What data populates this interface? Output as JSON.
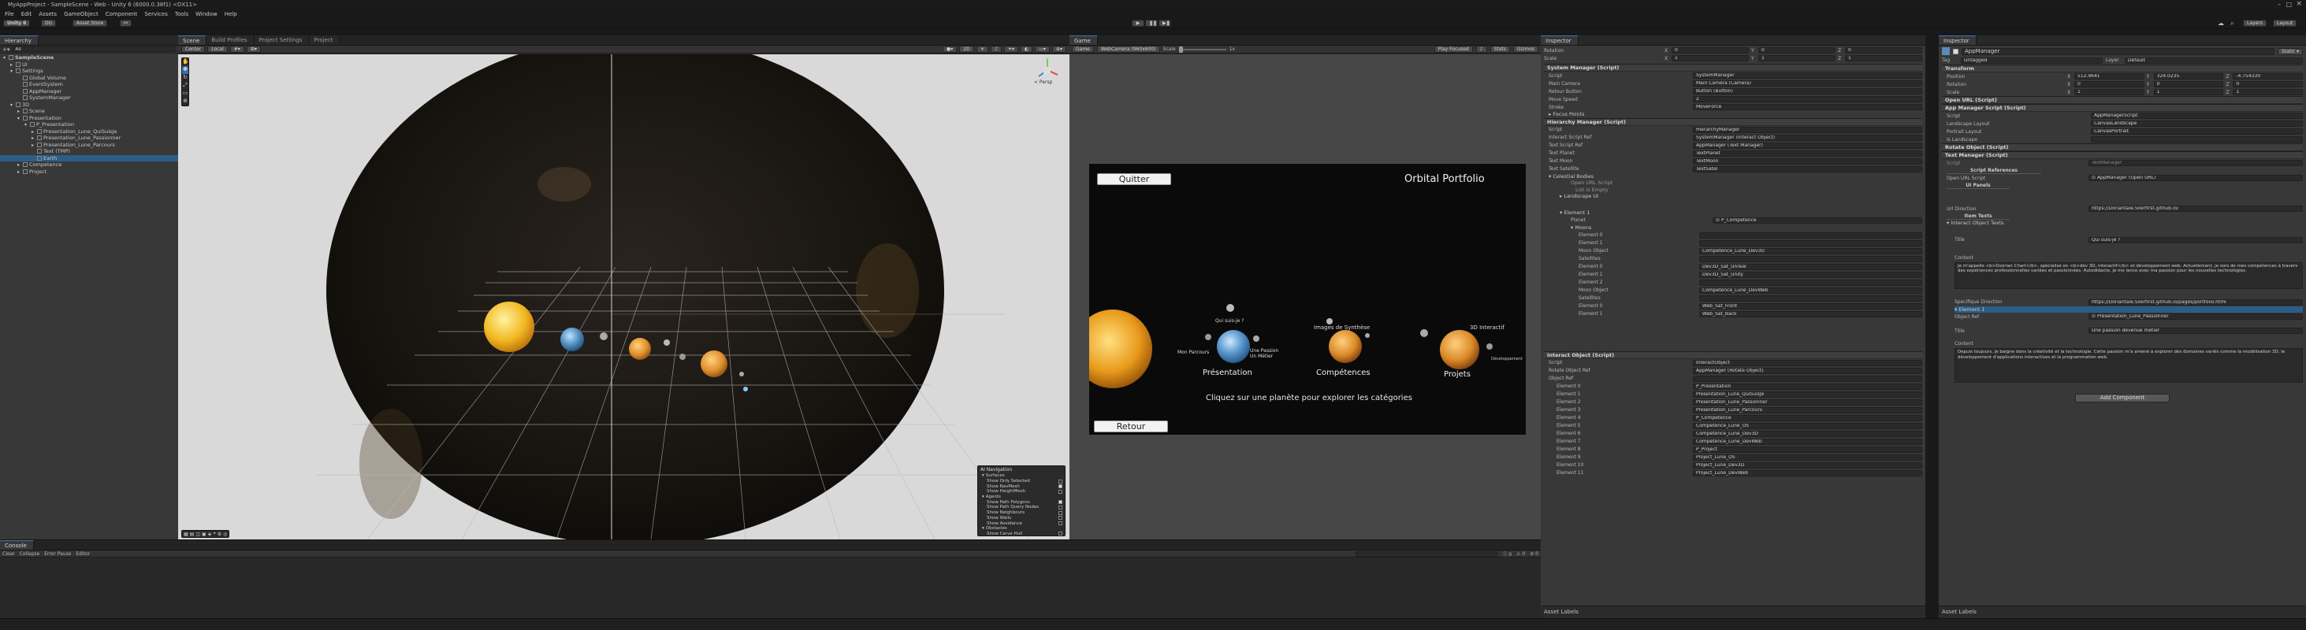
{
  "title_bar": {
    "text": "MyAppProject - SampleScene - Web - Unity 6 (6000.0.38f1) <DX11>"
  },
  "menu_items": [
    "File",
    "Edit",
    "Assets",
    "GameObject",
    "Component",
    "Services",
    "Tools",
    "Window",
    "Help"
  ],
  "toolbar": {
    "unity_label": "Unity 6",
    "account_label": "DG",
    "asset_store_label": "Asset Store",
    "layers_label": "Layers",
    "layout_label": "Layout"
  },
  "hierarchy": {
    "tab_label": "Hierarchy",
    "search_label": "All",
    "items": [
      {
        "label": "SampleScene",
        "depth": 0,
        "bold": true,
        "arrow": "▾"
      },
      {
        "label": "UI",
        "depth": 1,
        "arrow": "▸"
      },
      {
        "label": "Settings",
        "depth": 1,
        "arrow": "▾"
      },
      {
        "label": "Global Volume",
        "depth": 2,
        "arrow": ""
      },
      {
        "label": "EventSystem",
        "depth": 2,
        "arrow": ""
      },
      {
        "label": "AppManager",
        "depth": 2,
        "arrow": ""
      },
      {
        "label": "SystemManager",
        "depth": 2,
        "arrow": ""
      },
      {
        "label": "3D",
        "depth": 1,
        "arrow": "▾"
      },
      {
        "label": "Scene",
        "depth": 2,
        "arrow": "▸"
      },
      {
        "label": "Presentation",
        "depth": 2,
        "arrow": "▾"
      },
      {
        "label": "P_Presentation",
        "depth": 3,
        "arrow": "▾"
      },
      {
        "label": "Presentation_Lune_QuiSuisJe",
        "depth": 4,
        "arrow": "▸"
      },
      {
        "label": "Presentation_Lune_Passionner",
        "depth": 4,
        "arrow": "▸"
      },
      {
        "label": "Presentation_Lune_Parcours",
        "depth": 4,
        "arrow": "▸"
      },
      {
        "label": "Text (TMP)",
        "depth": 4,
        "arrow": ""
      },
      {
        "label": "Earth",
        "depth": 4,
        "arrow": "",
        "selected": true
      },
      {
        "label": "Competence",
        "depth": 2,
        "arrow": "▸"
      },
      {
        "label": "Project",
        "depth": 2,
        "arrow": "▸"
      }
    ]
  },
  "scene_tabs": [
    "Scene",
    "Build Profiles",
    "Project Settings",
    "Project"
  ],
  "scene_toolbar": {
    "center_label": "Center",
    "local_label": "Local",
    "persp_label": "< Persp"
  },
  "ai_nav": {
    "title": "AI Navigation",
    "items": [
      {
        "label": "Surfaces",
        "header": true
      },
      {
        "label": "Show Only Selected",
        "check": false
      },
      {
        "label": "Show NavMesh",
        "check": true
      },
      {
        "label": "Show HeightMesh",
        "check": false
      },
      {
        "label": "Agents",
        "header": true
      },
      {
        "label": "Show Path Polygons",
        "check": true
      },
      {
        "label": "Show Path Query Nodes",
        "check": false
      },
      {
        "label": "Show Neighbours",
        "check": false
      },
      {
        "label": "Show Walls",
        "check": false
      },
      {
        "label": "Show Avoidance",
        "check": false
      },
      {
        "label": "Obstacles",
        "header": true
      },
      {
        "label": "Show Carve Hull",
        "check": false
      }
    ]
  },
  "game_view": {
    "tab_label": "Game",
    "display_label": "Game",
    "resolution_label": "WebCamera (960x600)",
    "scale_label": "Scale",
    "scale_value": "1x",
    "play_focused_label": "Play Focused",
    "stats_label": "Stats",
    "gizmos_label": "Gizmos",
    "quit_button": "Quitter",
    "title": "Orbital Portfolio",
    "back_button": "Retour",
    "hint_text": "Cliquez sur une planète pour explorer les catégories",
    "labels": [
      {
        "text": "Qui suis-je ?"
      },
      {
        "text": "Mon Parcours"
      },
      {
        "text": "Une Passion Un Métier"
      },
      {
        "text": "Présentation"
      },
      {
        "text": "Images de Synthèse"
      },
      {
        "text": "3D Interactif"
      },
      {
        "text": "Compétences"
      },
      {
        "text": "Projets"
      },
      {
        "text": "Développement"
      }
    ]
  },
  "inspector1": {
    "tab_label": "Inspector",
    "top_rows": [
      {
        "label": "Rotation",
        "x": "0",
        "y": "0",
        "z": "0"
      },
      {
        "label": "Scale",
        "x": "1",
        "y": "1",
        "z": "1"
      }
    ],
    "system_manager": {
      "title": "System Manager (Script)",
      "fields": [
        {
          "label": "Script",
          "value": "SystemManager"
        },
        {
          "label": "Main Camera",
          "value": "Main Camera (Camera)"
        },
        {
          "label": "Retour Button",
          "value": "Button (Button)"
        },
        {
          "label": "Move Speed",
          "value": "2"
        },
        {
          "label": "Stroke",
          "value": "MoveForce"
        }
      ],
      "focus_points": "Focus Points"
    },
    "hierarchy_manager": {
      "title": "Hierarchy Manager (Script)",
      "fields": [
        {
          "label": "Script",
          "value": "HierarchyManager"
        },
        {
          "label": "Interact Script Ref",
          "value": "SystemManager (Interact Object)"
        },
        {
          "label": "Text Script Ref",
          "value": "AppManager (Text Manager)"
        },
        {
          "label": "Text Planet",
          "value": "TextPlanet"
        },
        {
          "label": "Text Moon",
          "value": "TextMoon"
        },
        {
          "label": "Text Satellite",
          "value": "TextSatel"
        }
      ],
      "celestial_bodies": "Celestial Bodies",
      "open_url_script": "Open URL Script",
      "list_empty": "List is Empty",
      "landscape_ui": "Landscape UI",
      "element1": "Element 1",
      "planet_value": "P_Competence",
      "moons_label": "Moons",
      "moon_elements": [
        {
          "label": "Element 0",
          "value": ""
        },
        {
          "label": "Element 1",
          "value": ""
        },
        {
          "label": "Moon Object",
          "value": "Competence_Lune_Dev3D"
        },
        {
          "label": "Satellites",
          "value": ""
        },
        {
          "label": "Element 0",
          "value": "Dev3D_Sat_Unreal"
        },
        {
          "label": "Element 1",
          "value": "Dev3D_Sat_Unity"
        },
        {
          "label": "Element 2",
          "value": ""
        },
        {
          "label": "Moon Object",
          "value": "Competence_Lune_DevWeb"
        },
        {
          "label": "Satellites",
          "value": ""
        },
        {
          "label": "Element 0",
          "value": "Web_Sat_Front"
        },
        {
          "label": "Element 1",
          "value": "Web_Sat_Back"
        }
      ]
    },
    "interact_object": {
      "title": "Interact Object (Script)",
      "fields": [
        {
          "label": "Script",
          "value": "InteractObject"
        },
        {
          "label": "Rotate Object Ref",
          "value": "AppManager (Rotate Object)"
        },
        {
          "label": "Object Ref",
          "value": ""
        }
      ],
      "object_count": "12",
      "elements": [
        {
          "label": "Element 0",
          "value": "P_Presentation"
        },
        {
          "label": "Element 1",
          "value": "Presentation_Lune_QuiSuisJe"
        },
        {
          "label": "Element 2",
          "value": "Presentation_Lune_Passionner"
        },
        {
          "label": "Element 3",
          "value": "Presentation_Lune_Parcours"
        },
        {
          "label": "Element 4",
          "value": "P_Competence"
        },
        {
          "label": "Element 5",
          "value": "Competence_Lune_OS"
        },
        {
          "label": "Element 6",
          "value": "Competence_Lune_Dev3D"
        },
        {
          "label": "Element 7",
          "value": "Competence_Lune_DevWeb"
        },
        {
          "label": "Element 8",
          "value": "P_Project"
        },
        {
          "label": "Element 9",
          "value": "Project_Lune_OS"
        },
        {
          "label": "Element 10",
          "value": "Project_Lune_Dev3D"
        },
        {
          "label": "Element 11",
          "value": "Project_Lune_DevWeb"
        }
      ]
    },
    "asset_labels": "Asset Labels"
  },
  "inspector2": {
    "tab_label": "Inspector",
    "object_name": "AppManager",
    "tag_label": "Tag",
    "tag_value": "Untagged",
    "layer_label": "Layer",
    "layer_value": "Default",
    "transform": {
      "title": "Transform",
      "rows": [
        {
          "label": "Position",
          "x": "512.9641",
          "y": "324.0235",
          "z": "-4.754330"
        },
        {
          "label": "Rotation",
          "x": "0",
          "y": "0",
          "z": "0"
        },
        {
          "label": "Scale",
          "x": "1",
          "y": "1",
          "z": "1"
        }
      ]
    },
    "components": [
      {
        "title": "Open URL (Script)"
      },
      {
        "title": "App Manager Script (Script)"
      }
    ],
    "app_manager_fields": [
      {
        "label": "Script",
        "value": "AppManagerScript"
      },
      {
        "label": "Landscape Layout",
        "value": "CanvasLandscape"
      },
      {
        "label": "Portrait Layout",
        "value": "CanvasPortrait"
      },
      {
        "label": "Is Landscape",
        "value": ""
      }
    ],
    "components2": [
      {
        "title": "Rotate Object (Script)"
      },
      {
        "title": "Text Manager (Script)"
      }
    ],
    "text_manager": {
      "script_label": "Script",
      "script_value": "TextManager",
      "script_refs": "Script References",
      "open_url_label": "Open URL Script",
      "open_url_value": "AppManager (Open URL)",
      "ui_panels": "UI Panels",
      "url_direction_label": "Url Direction",
      "url_direction_value": "https://Doriantale.Silerfirst.github.io/",
      "item_texts": "Item Texts",
      "interact_texts": "Interact Object Texts",
      "title_label": "Title",
      "title_value": "Qui suis-je ?",
      "content_label": "Content",
      "content_text": "Je m'appelle <b>Doorian Chart</b>, spécialisé en <b>dév 3D, interactif</b> et développement web. Actuellement, je sors de mes compétences à travers des expériences professionnelles variées et passionnées. Autodidacte, je me lance avec ma passion pour les nouvelles technologies.",
      "specifique_label": "Specifique Direction",
      "specifique_value": "https://Doriantale.Silerfirst.github.io/pages/portfolio.html",
      "element1_label": "Element 1",
      "object_ref_label": "Object Ref",
      "object_ref_value": "Presentation_Lune_Passionner",
      "title2_value": "Une passion devenue métier",
      "content2_text": "Depuis toujours, je baigne dans la créativité et la technologie. Cette passion m'a amené à explorer des domaines variés comme la modélisation 3D, le développement d'applications interactives et la programmation web."
    },
    "add_component": "Add Component",
    "asset_labels": "Asset Labels"
  },
  "console": {
    "tab_label": "Console",
    "clear_label": "Clear",
    "collapse_label": "Collapse",
    "error_pause_label": "Error Pause",
    "editor_label": "Editor",
    "counts": [
      "0",
      "0",
      "0"
    ]
  }
}
